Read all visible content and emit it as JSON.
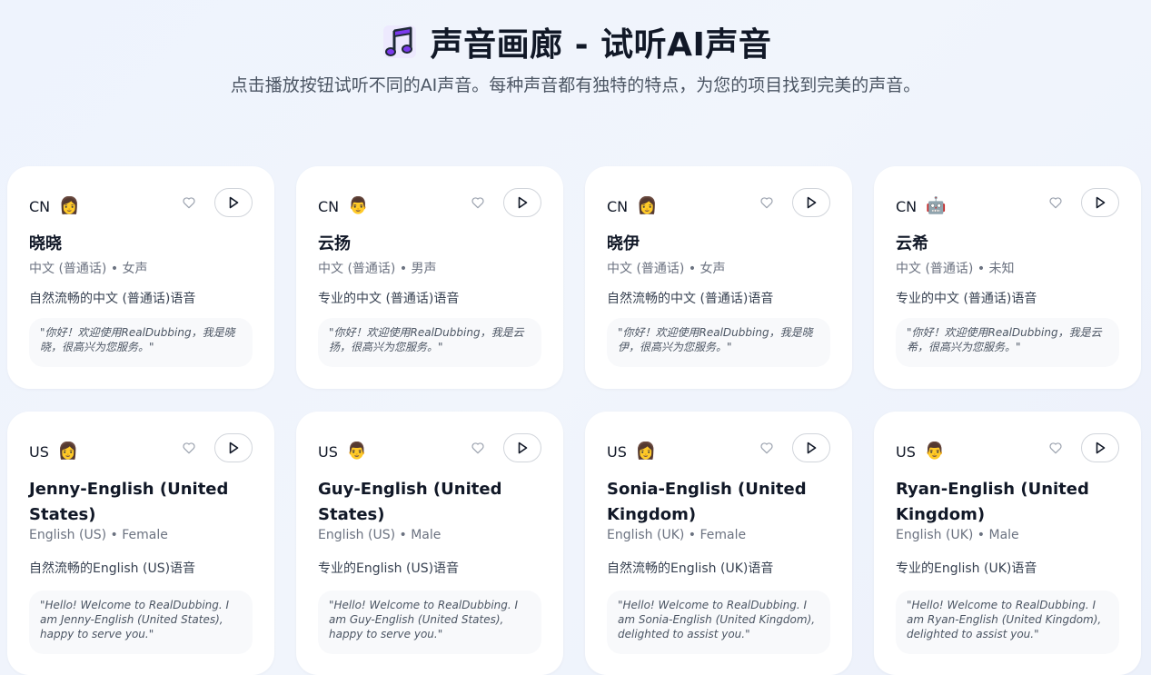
{
  "header": {
    "title": "声音画廊 - 试听AI声音",
    "subtitle": "点击播放按钮试听不同的AI声音。每种声音都有独特的特点，为您的项目找到完美的声音。"
  },
  "voices": [
    {
      "region": "CN",
      "avatar": "👩",
      "avatar_icon": "woman-avatar-icon",
      "name": "晓晓",
      "meta": "中文 (普通话) • 女声",
      "desc": "自然流畅的中文 (普通话)语音",
      "sample": "\"你好！欢迎使用RealDubbing，我是晓晓，很高兴为您服务。\""
    },
    {
      "region": "CN",
      "avatar": "👨",
      "avatar_icon": "man-avatar-icon",
      "name": "云扬",
      "meta": "中文 (普通话) • 男声",
      "desc": "专业的中文 (普通话)语音",
      "sample": "\"你好！欢迎使用RealDubbing，我是云扬，很高兴为您服务。\""
    },
    {
      "region": "CN",
      "avatar": "👩",
      "avatar_icon": "woman-avatar-icon",
      "name": "晓伊",
      "meta": "中文 (普通话) • 女声",
      "desc": "自然流畅的中文 (普通话)语音",
      "sample": "\"你好！欢迎使用RealDubbing，我是晓伊，很高兴为您服务。\""
    },
    {
      "region": "CN",
      "avatar": "🤖",
      "avatar_icon": "robot-avatar-icon",
      "name": "云希",
      "meta": "中文 (普通话) • 未知",
      "desc": "专业的中文 (普通话)语音",
      "sample": "\"你好！欢迎使用RealDubbing，我是云希，很高兴为您服务。\""
    },
    {
      "region": "US",
      "avatar": "👩",
      "avatar_icon": "woman-avatar-icon",
      "name": "Jenny-English (United States)",
      "meta": "English (US) • Female",
      "desc": "自然流畅的English (US)语音",
      "sample": "\"Hello! Welcome to RealDubbing. I am Jenny-English (United States), happy to serve you.\""
    },
    {
      "region": "US",
      "avatar": "👨",
      "avatar_icon": "man-avatar-icon",
      "name": "Guy-English (United States)",
      "meta": "English (US) • Male",
      "desc": "专业的English (US)语音",
      "sample": "\"Hello! Welcome to RealDubbing. I am Guy-English (United States), happy to serve you.\""
    },
    {
      "region": "US",
      "avatar": "👩",
      "avatar_icon": "woman-avatar-icon",
      "name": "Sonia-English (United Kingdom)",
      "meta": "English (UK) • Female",
      "desc": "自然流畅的English (UK)语音",
      "sample": "\"Hello! Welcome to RealDubbing. I am Sonia-English (United Kingdom), delighted to assist you.\""
    },
    {
      "region": "US",
      "avatar": "👨",
      "avatar_icon": "man-avatar-icon",
      "name": "Ryan-English (United Kingdom)",
      "meta": "English (UK) • Male",
      "desc": "专业的English (UK)语音",
      "sample": "\"Hello! Welcome to RealDubbing. I am Ryan-English (United Kingdom), delighted to assist you.\""
    }
  ],
  "colors": {
    "accent_note": "#7c3aed",
    "title_text": "#111827",
    "muted_text": "#6b7280",
    "sample_bg": "#f8f9fb"
  },
  "icons": {
    "title": "music-note-icon",
    "favorite": "heart-icon",
    "play": "play-icon"
  }
}
